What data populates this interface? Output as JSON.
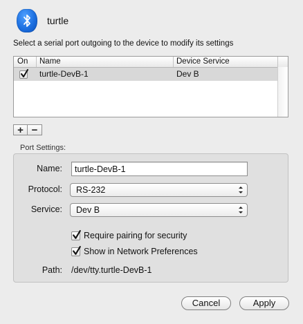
{
  "header": {
    "icon": "bluetooth-icon",
    "device_name": "turtle"
  },
  "instruction": "Select a serial port outgoing to the device to modify its settings",
  "table": {
    "columns": [
      "On",
      "Name",
      "Device Service"
    ],
    "rows": [
      {
        "on": true,
        "name": "turtle-DevB-1",
        "service": "Dev B"
      }
    ]
  },
  "list_buttons": {
    "add": "+",
    "remove": "−"
  },
  "port_settings": {
    "group_label": "Port Settings:",
    "name_label": "Name:",
    "name_value": "turtle-DevB-1",
    "protocol_label": "Protocol:",
    "protocol_value": "RS-232",
    "service_label": "Service:",
    "service_value": "Dev B",
    "require_pairing": {
      "label": "Require pairing for security",
      "checked": true
    },
    "show_network": {
      "label": "Show in Network Preferences",
      "checked": true
    },
    "path_label": "Path:",
    "path_value": "/dev/tty.turtle-DevB-1"
  },
  "footer": {
    "cancel": "Cancel",
    "apply": "Apply"
  },
  "colors": {
    "bluetooth_blue": "#1c6fe0",
    "selection_gray": "#d8d8d8"
  }
}
